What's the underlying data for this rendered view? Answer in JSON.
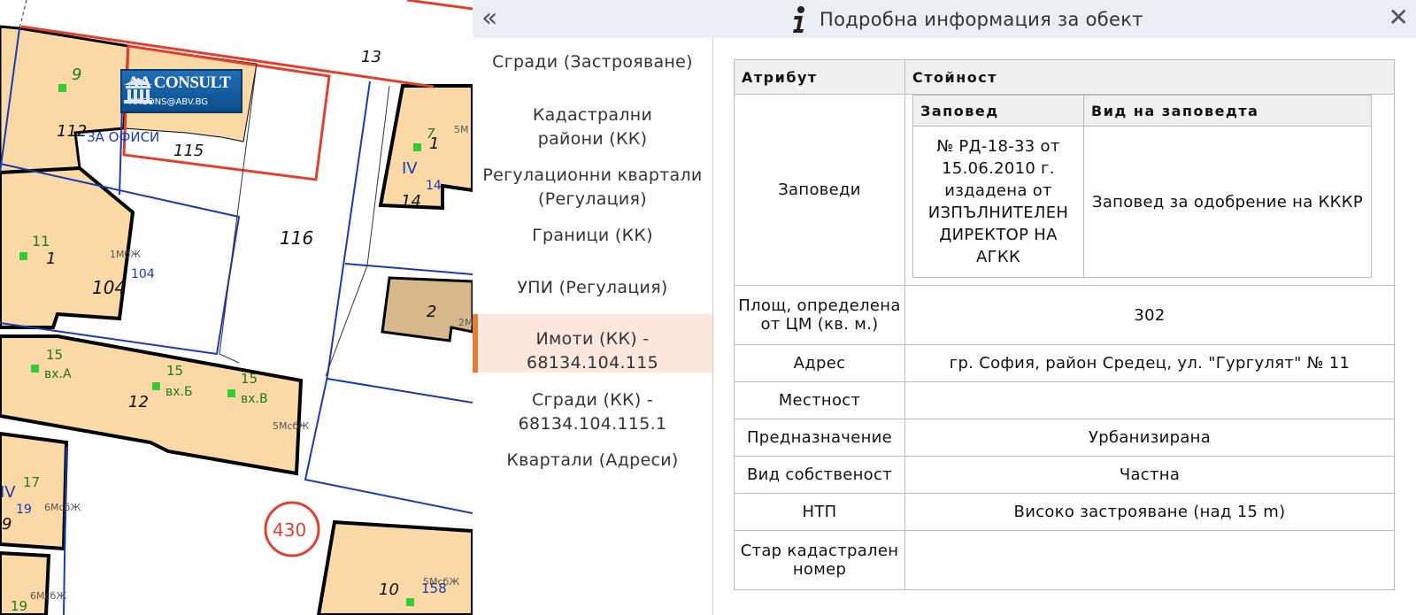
{
  "map": {
    "lot_labels": [
      "9",
      "112",
      "115",
      "13",
      "7",
      "1",
      "IV",
      "14",
      "14",
      "116",
      "11",
      "1",
      "104",
      "104",
      "2",
      "15",
      "вх.А",
      "15",
      "вх.Б",
      "15",
      "вх.В",
      "12",
      "IV",
      "17",
      "19",
      "9",
      "430",
      "10",
      "158",
      "19"
    ],
    "building_codes": [
      "5М",
      "1МбЖ",
      "2М",
      "5МсбЖ",
      "6МсбЖ",
      "6МсбЖ",
      "5МсбЖ"
    ],
    "office_label": "ЗА ОФИСИ",
    "logo_title": "AA CONSULT",
    "logo_email": "AACONS@ABV.BG"
  },
  "header": {
    "collapse_icon": "«",
    "title": "Подробна информация за обект",
    "close_icon": "✕"
  },
  "nav": {
    "items": [
      {
        "label": "Сгради (Застрояване)"
      },
      {
        "label": "Кадастрални райони (КК)"
      },
      {
        "label": "Регулационни квартали (Регулация)"
      },
      {
        "label": "Граници (КК)"
      },
      {
        "label": "УПИ (Регулация)"
      },
      {
        "label": "Имоти (КК) - 68134.104.115"
      },
      {
        "label": "Сгради (КК) - 68134.104.115.1"
      },
      {
        "label": "Квартали (Адреси)"
      }
    ],
    "active_index": 5
  },
  "table": {
    "col_attr": "Атрибут",
    "col_value": "Стойност",
    "orders": {
      "label": "Заповеди",
      "sub_col_order": "Заповед",
      "sub_col_type": "Вид на заповедта",
      "order_text": "№ РД-18-33 от 15.06.2010 г. издадена от ИЗПЪЛНИТЕЛЕН ДИРЕКТОР НА АГКК",
      "order_type": "Заповед за одобрение на КККР"
    },
    "rows": [
      {
        "attr": "Площ, определена от ЦМ (кв. м.)",
        "value": "302"
      },
      {
        "attr": "Адрес",
        "value": "гр. София, район Средец, ул. \"Гургулят\" № 11"
      },
      {
        "attr": "Местност",
        "value": ""
      },
      {
        "attr": "Предназначение",
        "value": "Урбанизирана"
      },
      {
        "attr": "Вид собственост",
        "value": "Частна"
      },
      {
        "attr": "НТП",
        "value": "Високо застрояване (над 15 m)"
      },
      {
        "attr": "Стар кадастрален номер",
        "value": ""
      }
    ]
  }
}
